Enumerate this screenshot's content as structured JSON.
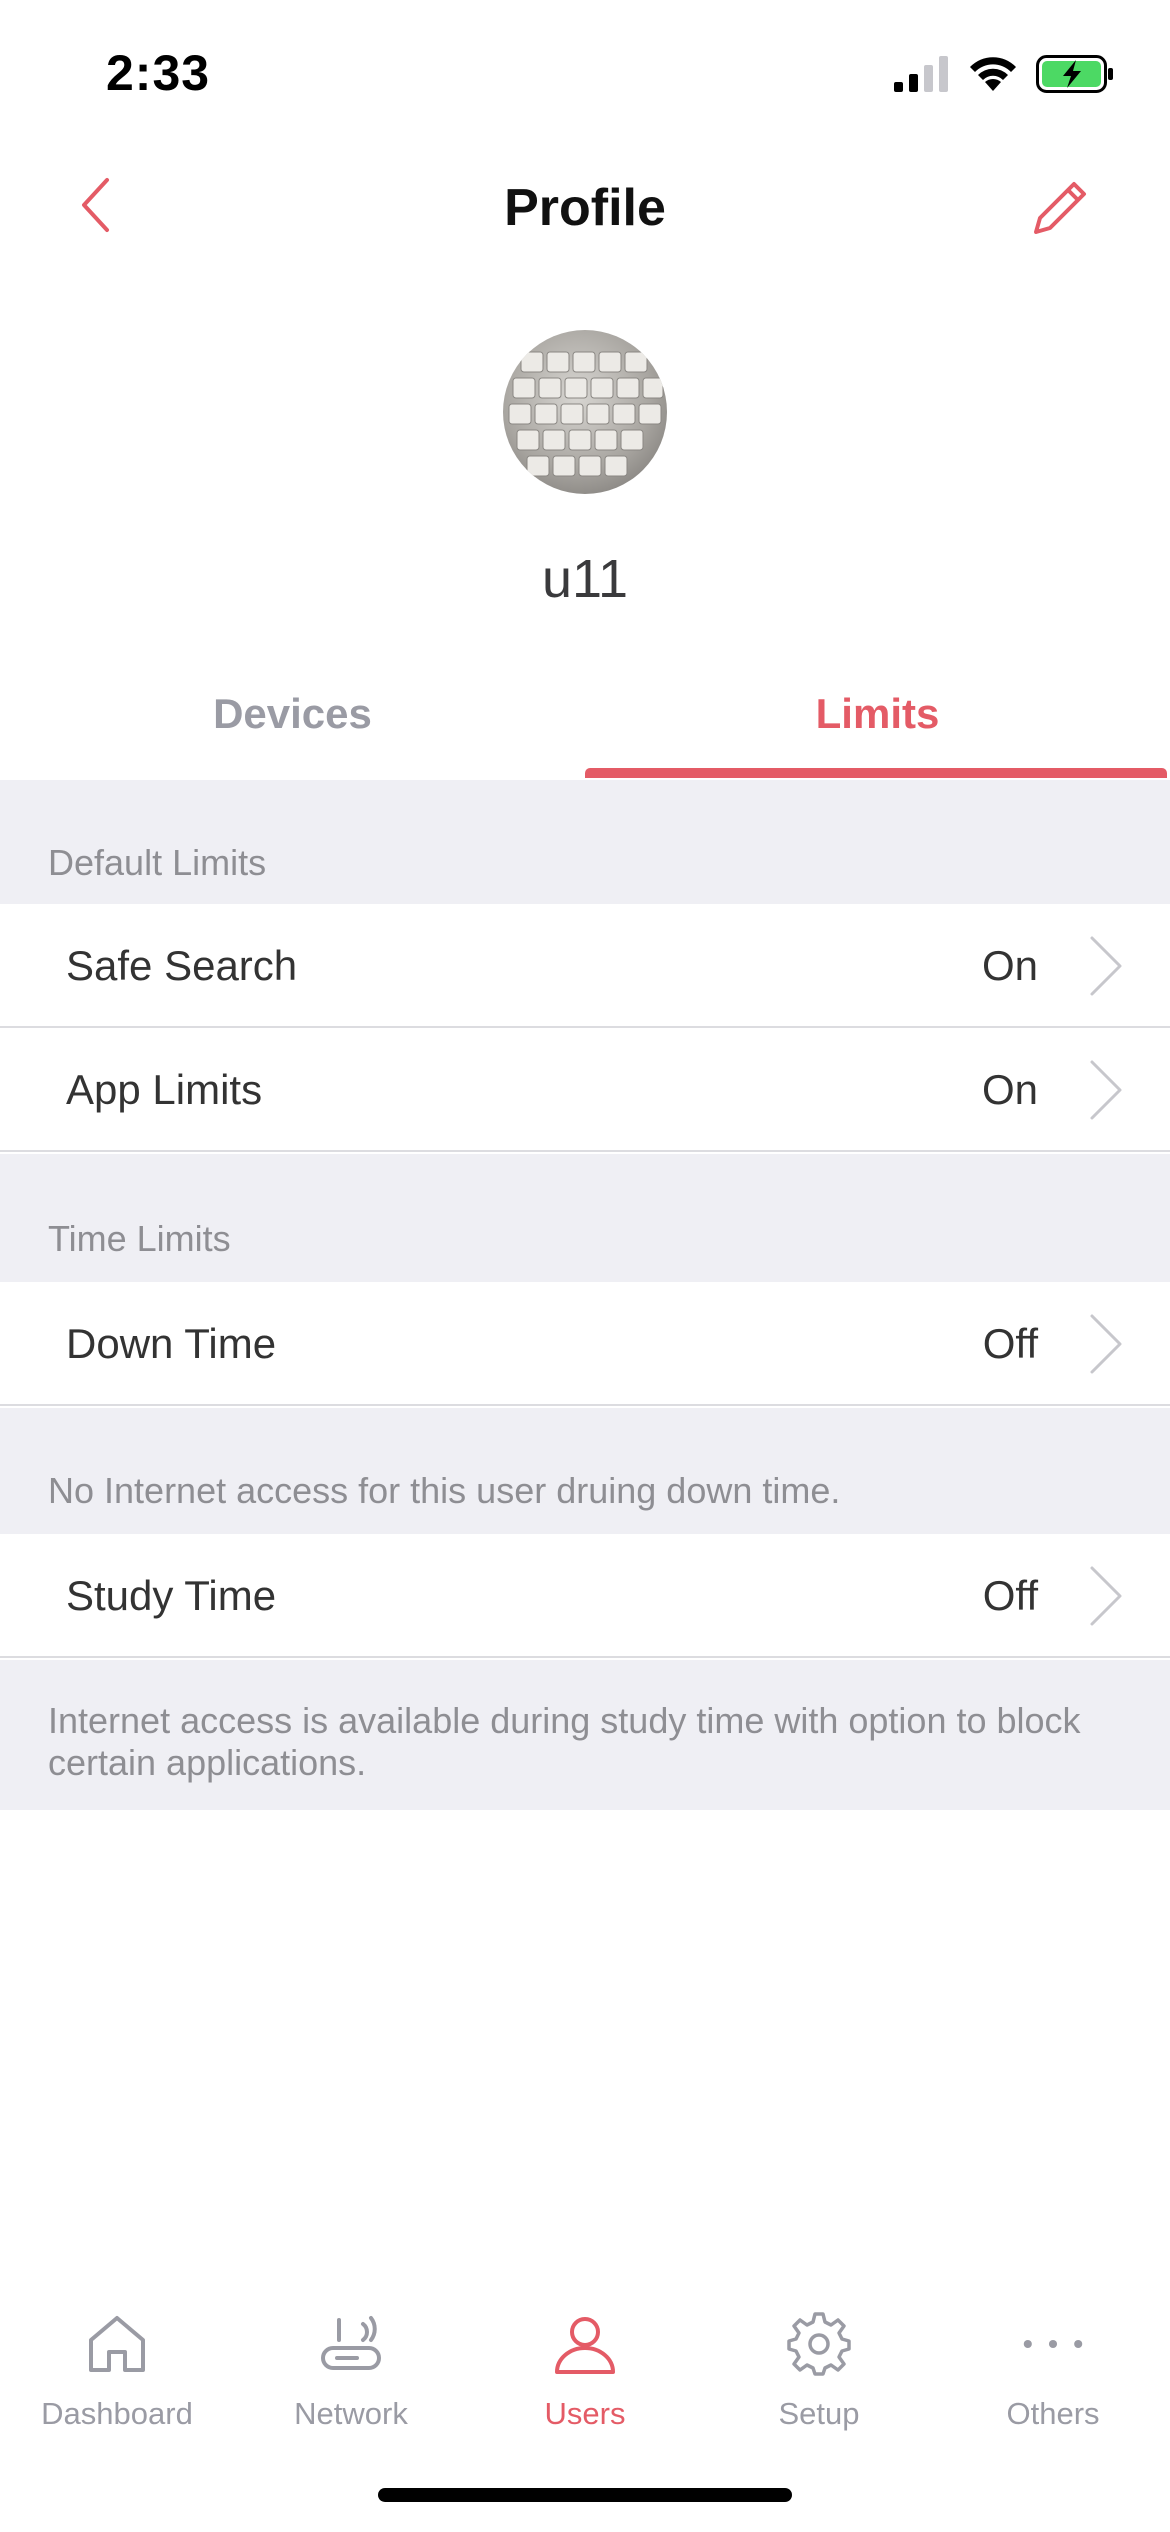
{
  "status_bar": {
    "time": "2:33"
  },
  "nav": {
    "title": "Profile"
  },
  "profile": {
    "username": "u11"
  },
  "tabs": [
    {
      "label": "Devices",
      "active": false
    },
    {
      "label": "Limits",
      "active": true
    }
  ],
  "default_limits": {
    "header": "Default Limits",
    "rows": [
      {
        "label": "Safe Search",
        "value": "On"
      },
      {
        "label": "App Limits",
        "value": "On"
      }
    ]
  },
  "time_limits": {
    "header": "Time Limits",
    "down_time": {
      "label": "Down Time",
      "value": "Off",
      "note": "No Internet access for this user druing down time."
    },
    "study_time": {
      "label": "Study Time",
      "value": "Off",
      "note": "Internet access is available during study time with option to block certain applications."
    }
  },
  "tab_bar": [
    {
      "label": "Dashboard",
      "icon": "home-icon",
      "active": false
    },
    {
      "label": "Network",
      "icon": "router-icon",
      "active": false
    },
    {
      "label": "Users",
      "icon": "user-icon",
      "active": true
    },
    {
      "label": "Setup",
      "icon": "gear-icon",
      "active": false
    },
    {
      "label": "Others",
      "icon": "more-icon",
      "active": false
    }
  ],
  "colors": {
    "accent": "#e45b66",
    "muted": "#9a9ba4",
    "section_bg": "#efeff4",
    "battery": "#4cd964"
  }
}
